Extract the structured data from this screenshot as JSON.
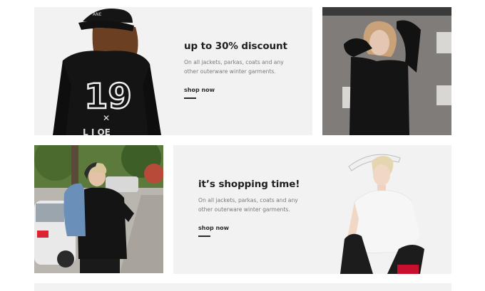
{
  "banner1": {
    "headline": "up to 30% discount",
    "description": "On all jackets, parkas, coats and any other outerware winter garments.",
    "cta": "shop now",
    "jersey_number": "19",
    "jersey_text": "L I OE"
  },
  "banner2": {
    "headline": "it’s shopping time!",
    "description": "On all jackets, parkas, coats and any other outerware winter garments.",
    "cta": "shop now"
  },
  "photos": {
    "model_black_sweater": "woman-black-sweater-photo",
    "model_denim_jacket": "man-denim-jacket-photo",
    "model_white_visor": "woman-white-visor-photo"
  },
  "colors": {
    "panel_bg": "#f2f2f2",
    "headline": "#1f1f1f",
    "body_text": "#7a7a7a"
  }
}
